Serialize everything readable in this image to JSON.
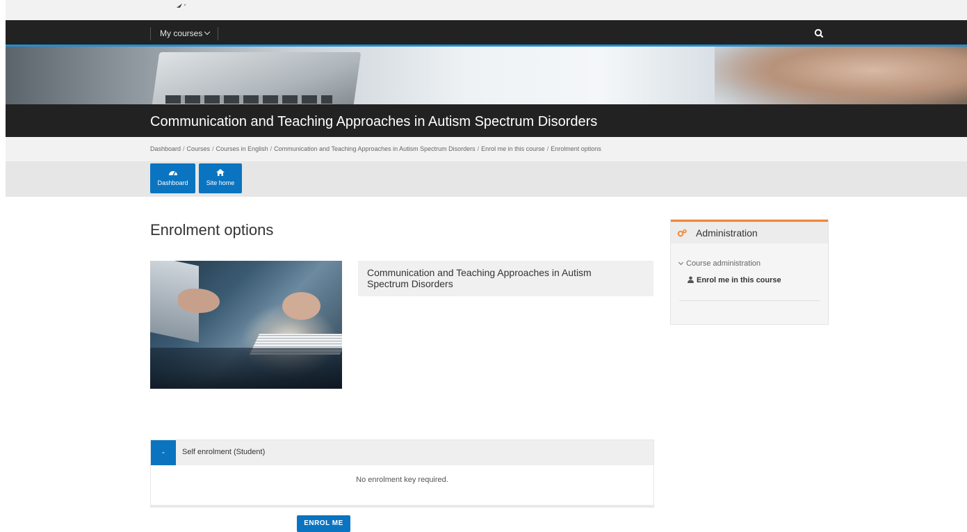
{
  "nav": {
    "my_courses": "My courses",
    "search_icon": "search-icon"
  },
  "course": {
    "title": "Communication and Teaching Approaches in Autism Spectrum Disorders"
  },
  "breadcrumb": [
    "Dashboard",
    "Courses",
    "Courses in English",
    "Communication and Teaching Approaches in Autism Spectrum Disorders",
    "Enrol me in this course",
    "Enrolment options"
  ],
  "quick_buttons": [
    {
      "label": "Dashboard",
      "icon": "dashboard-icon"
    },
    {
      "label": "Site home",
      "icon": "home-icon"
    }
  ],
  "main": {
    "heading": "Enrolment options",
    "course_name": "Communication and Teaching Approaches in Autism Spectrum Disorders"
  },
  "admin": {
    "title": "Administration",
    "section": "Course administration",
    "enrol_link": "Enrol me in this course"
  },
  "enrolment": {
    "toggle": "-",
    "method_title": "Self enrolment (Student)",
    "note": "No enrolment key required.",
    "button": "ENROL ME"
  },
  "colors": {
    "primary": "#0b74c0",
    "navbar": "#222222",
    "accent_line": "#1e8fd4",
    "admin_accent": "#f0883a"
  }
}
